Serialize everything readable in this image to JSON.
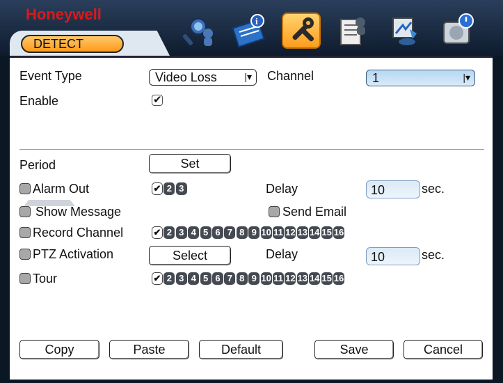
{
  "brand": "Honeywell",
  "tab": "DETECT",
  "toolbar_icons": [
    "search-user-icon",
    "info-book-icon",
    "tools-icon",
    "checklist-user-icon",
    "network-drive-icon",
    "disk-power-icon"
  ],
  "colors": {
    "accent_tab": "#ff9a1a",
    "dropdown_highlight": "#b6d7f3",
    "brand_red": "#d81a1a"
  },
  "form": {
    "event_type_label": "Event Type",
    "event_type_value": "Video Loss",
    "channel_label": "Channel",
    "channel_value": "1",
    "enable_label": "Enable",
    "enable_checked": true,
    "period_label": "Period",
    "set_button": "Set",
    "alarm_out_label": "Alarm Out",
    "alarm_out_channels": [
      "1",
      "2",
      "3"
    ],
    "alarm_out_checked": [
      "1"
    ],
    "delay_label": "Delay",
    "alarm_delay_value": "10",
    "sec_label": "sec.",
    "show_message_label": "Show Message",
    "send_email_label": "Send Email",
    "record_channel_label": "Record Channel",
    "record_channels": [
      "1",
      "2",
      "3",
      "4",
      "5",
      "6",
      "7",
      "8",
      "9",
      "10",
      "11",
      "12",
      "13",
      "14",
      "15",
      "16"
    ],
    "record_checked": [
      "1"
    ],
    "ptz_label": "PTZ Activation",
    "select_button": "Select",
    "ptz_delay_value": "10",
    "tour_label": "Tour",
    "tour_channels": [
      "1",
      "2",
      "3",
      "4",
      "5",
      "6",
      "7",
      "8",
      "9",
      "10",
      "11",
      "12",
      "13",
      "14",
      "15",
      "16"
    ],
    "tour_checked": [
      "1"
    ]
  },
  "buttons": {
    "copy": "Copy",
    "paste": "Paste",
    "default": "Default",
    "save": "Save",
    "cancel": "Cancel"
  }
}
